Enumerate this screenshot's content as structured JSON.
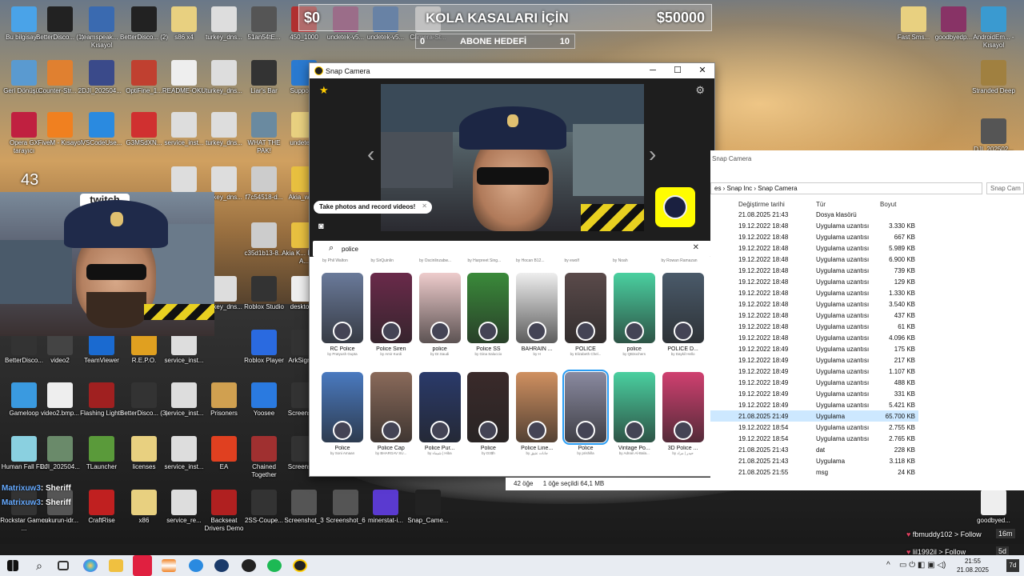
{
  "overlay": {
    "banner_left": "$0",
    "banner_mid": "KOLA KASALARI İÇİN",
    "banner_right": "$50000",
    "abone_left": "0",
    "abone_text": "ABONE HEDEFİ",
    "abone_right": "10",
    "timer": "43"
  },
  "desktop_icons": [
    {
      "label": "Bu bilgisayar",
      "color": "#4aa3e8"
    },
    {
      "label": "BetterDisco... (1)",
      "color": "#222"
    },
    {
      "label": "teamspeak... - Kısayol",
      "color": "#3a6ab0"
    },
    {
      "label": "BetterDisco... (2)",
      "color": "#222"
    },
    {
      "label": "s86 x4",
      "color": "#e8d080"
    },
    {
      "label": "turkey_dns...",
      "color": "#ddd"
    },
    {
      "label": "51an54tE...",
      "color": "#555"
    },
    {
      "label": "450_1000",
      "color": "#b03030"
    },
    {
      "label": "undetek-v5...",
      "color": "#883366"
    },
    {
      "label": "undetek-v5...",
      "color": "#2a5a9a"
    },
    {
      "label": "Camera-St...",
      "color": "#ccc"
    },
    {
      "label": "Fast Sms...",
      "color": "#e8d080"
    },
    {
      "label": "goodbyedp...",
      "color": "#883366"
    },
    {
      "label": "AndroidEm... - Kısayol",
      "color": "#3a9ad0"
    },
    {
      "label": "Geri Dönüşü...",
      "color": "#5a9ad0"
    },
    {
      "label": "Counter-Str... 2",
      "color": "#e08030"
    },
    {
      "label": "DJI_202504...",
      "color": "#3a4a8a"
    },
    {
      "label": "OptiFine_1...",
      "color": "#c04030"
    },
    {
      "label": "README-OKU",
      "color": "#eee"
    },
    {
      "label": "turkey_dns...",
      "color": "#ddd"
    },
    {
      "label": "Liar's Bar",
      "color": "#333"
    },
    {
      "label": "Support...",
      "color": "#2a7ad0"
    },
    {
      "label": "Stranded Deep",
      "color": "#a08040"
    },
    {
      "label": "Opera GX tarayıcı",
      "color": "#c02040"
    },
    {
      "label": "FiveM - Kısayol",
      "color": "#f08020"
    },
    {
      "label": "VSCodeUse...",
      "color": "#2a8ae0"
    },
    {
      "label": "G3MSdXN...",
      "color": "#d03030"
    },
    {
      "label": "service_inst...",
      "color": "#ddd"
    },
    {
      "label": "turkey_dns...",
      "color": "#ddd"
    },
    {
      "label": "WHAT THE PAK!",
      "color": "#6a8aa0"
    },
    {
      "label": "undetek...",
      "color": "#e8d080"
    },
    {
      "label": "DJI_202502...",
      "color": "#555"
    },
    {
      "label": "service_inst...",
      "color": "#ddd"
    },
    {
      "label": "turkey_dns...",
      "color": "#ddd"
    },
    {
      "label": "f7c54518-d...",
      "color": "#ccc"
    },
    {
      "label": "Akia_win...",
      "color": "#e8c040"
    },
    {
      "label": "c35d1b13-8...",
      "color": "#ccc"
    },
    {
      "label": "Akia K... İzleme A...",
      "color": "#e8c040"
    },
    {
      "label": "turkey_dns...",
      "color": "#ddd"
    },
    {
      "label": "Roblox Studio",
      "color": "#333"
    },
    {
      "label": "desktop...",
      "color": "#eee"
    },
    {
      "label": "BetterDisco...",
      "color": "#333"
    },
    {
      "label": "video2",
      "color": "#444"
    },
    {
      "label": "TeamViewer",
      "color": "#1a6ad0"
    },
    {
      "label": "R.E.P.O.",
      "color": "#e0a020"
    },
    {
      "label": "service_inst...",
      "color": "#ddd"
    },
    {
      "label": "Roblox Player",
      "color": "#2a6ae0"
    },
    {
      "label": "ArkSigne...",
      "color": "#333"
    },
    {
      "label": "Gameloop",
      "color": "#3a9ae0"
    },
    {
      "label": "video2.bmp...",
      "color": "#eee"
    },
    {
      "label": "Flashing Lights",
      "color": "#a02020"
    },
    {
      "label": "BetterDisco... (3)",
      "color": "#333"
    },
    {
      "label": "service_inst...",
      "color": "#ddd"
    },
    {
      "label": "Prisoners",
      "color": "#d0a050"
    },
    {
      "label": "Yoosee",
      "color": "#2a7ae0"
    },
    {
      "label": "Screensh...",
      "color": "#333"
    },
    {
      "label": "Human Fall Flat",
      "color": "#8ad0e0"
    },
    {
      "label": "DJI_202504...",
      "color": "#6a8a6a"
    },
    {
      "label": "TLauncher",
      "color": "#5a9a3a"
    },
    {
      "label": "licenses",
      "color": "#e8d080"
    },
    {
      "label": "service_inst...",
      "color": "#ddd"
    },
    {
      "label": "EA",
      "color": "#e04020"
    },
    {
      "label": "Chained Together",
      "color": "#a03030"
    },
    {
      "label": "Screensh...",
      "color": "#333"
    },
    {
      "label": "Rockstar Games ...",
      "color": "#333"
    },
    {
      "label": "cukurun-idr...",
      "color": "#555"
    },
    {
      "label": "CraftRise",
      "color": "#c02020"
    },
    {
      "label": "x86",
      "color": "#e8d080"
    },
    {
      "label": "service_re...",
      "color": "#ddd"
    },
    {
      "label": "Backseat Drivers Demo",
      "color": "#b02020"
    },
    {
      "label": "2SS-Coupe...",
      "color": "#333"
    },
    {
      "label": "Screenshot_3",
      "color": "#555"
    },
    {
      "label": "Screenshot_6",
      "color": "#555"
    },
    {
      "label": "minerstat-i...",
      "color": "#5a3ad0"
    },
    {
      "label": "Snap_Came...",
      "color": "#222"
    },
    {
      "label": "goodbyed...",
      "color": "#eee"
    }
  ],
  "webcam": {
    "twitch_label": "twitch"
  },
  "snap": {
    "window_title": "Snap Camera",
    "min": "─",
    "max": "☐",
    "close": "✕",
    "star": "★",
    "gear": "⚙",
    "prev_arrow": "‹",
    "next_arrow": "›",
    "tooltip": "Take photos and record videos!",
    "tooltip_close": "✕",
    "camera_icon": "◙",
    "search_icon": "⌕",
    "search_value": "police",
    "search_close": "✕",
    "bylines_top": [
      "by Phil Walton",
      "by SirQuinlin",
      "by Oscinlinzabw...",
      "by Harpreet Sing...",
      "by Hocan B12...",
      "by ewolf",
      "by Noah",
      "by Rowan Ramazan"
    ],
    "lenses_row1": [
      {
        "name": "RC Police",
        "by": "by Pratyush Gupta",
        "color": "#6a7a9a"
      },
      {
        "name": "Police Siren",
        "by": "by Amir Kurdi",
        "color": "#6a2a4a"
      },
      {
        "name": "police",
        "by": "by Dr.Saudi",
        "color": "#eecccc"
      },
      {
        "name": "Police SS",
        "by": "by Gina Saluccio",
        "color": "#3a8a3a"
      },
      {
        "name": "BAHRAIN ...",
        "by": "by H",
        "color": "#eee"
      },
      {
        "name": "POLICE",
        "by": "by Elizabeth Chel...",
        "color": "#5a4a4a"
      },
      {
        "name": "police",
        "by": "by QB3ochers",
        "color": "#4ad0a0"
      },
      {
        "name": "POLICE D...",
        "by": "by Daykil Hello",
        "color": "#4a5a6a"
      }
    ],
    "lenses_row2": [
      {
        "name": "Police",
        "by": "by Soni Amaan",
        "color": "#4a7ac0"
      },
      {
        "name": "Police Cap",
        "by": "by BHARGAV SU...",
        "color": "#8a6a5a"
      },
      {
        "name": "Police Pur...",
        "by": "by شيماء | Hiba",
        "color": "#2a3a6a"
      },
      {
        "name": "Police",
        "by": "by D3$h",
        "color": "#3a2a2a"
      },
      {
        "name": "Police Line...",
        "by": "by جانات عتيق",
        "color": "#d09060"
      },
      {
        "name": "Police",
        "by": "by prishilla",
        "color": "#8a8aa0"
      },
      {
        "name": "Vintage Po...",
        "by": "by Adnan Al-Bala...",
        "color": "#4ad0a0"
      },
      {
        "name": "3D Police ...",
        "by": "by حيدر | مراد",
        "color": "#d04070"
      }
    ]
  },
  "explorer": {
    "title": "Snap Camera",
    "breadcrumb": "es  ›  Snap Inc  ›  Snap Camera",
    "search_placeholder": "Snap Cam",
    "headers": {
      "date": "Değiştirme tarihi",
      "type": "Tür",
      "size": "Boyut"
    },
    "rows": [
      {
        "date": "21.08.2025 21:43",
        "type": "Dosya klasörü",
        "size": ""
      },
      {
        "date": "19.12.2022 18:48",
        "type": "Uygulama uzantısı",
        "size": "3.330 KB"
      },
      {
        "date": "19.12.2022 18:48",
        "type": "Uygulama uzantısı",
        "size": "667 KB"
      },
      {
        "date": "19.12.2022 18:48",
        "type": "Uygulama uzantısı",
        "size": "5.989 KB"
      },
      {
        "date": "19.12.2022 18:48",
        "type": "Uygulama uzantısı",
        "size": "6.900 KB"
      },
      {
        "date": "19.12.2022 18:48",
        "type": "Uygulama uzantısı",
        "size": "739 KB"
      },
      {
        "date": "19.12.2022 18:48",
        "type": "Uygulama uzantısı",
        "size": "129 KB"
      },
      {
        "date": "19.12.2022 18:48",
        "type": "Uygulama uzantısı",
        "size": "1.330 KB"
      },
      {
        "date": "19.12.2022 18:48",
        "type": "Uygulama uzantısı",
        "size": "3.540 KB"
      },
      {
        "date": "19.12.2022 18:48",
        "type": "Uygulama uzantısı",
        "size": "437 KB"
      },
      {
        "date": "19.12.2022 18:48",
        "type": "Uygulama uzantısı",
        "size": "61 KB"
      },
      {
        "date": "19.12.2022 18:48",
        "type": "Uygulama uzantısı",
        "size": "4.096 KB"
      },
      {
        "date": "19.12.2022 18:49",
        "type": "Uygulama uzantısı",
        "size": "175 KB"
      },
      {
        "date": "19.12.2022 18:49",
        "type": "Uygulama uzantısı",
        "size": "217 KB"
      },
      {
        "date": "19.12.2022 18:49",
        "type": "Uygulama uzantısı",
        "size": "1.107 KB"
      },
      {
        "date": "19.12.2022 18:49",
        "type": "Uygulama uzantısı",
        "size": "488 KB"
      },
      {
        "date": "19.12.2022 18:49",
        "type": "Uygulama uzantısı",
        "size": "331 KB"
      },
      {
        "date": "19.12.2022 18:49",
        "type": "Uygulama uzantısı",
        "size": "5.421 KB"
      },
      {
        "date": "21.08.2025 21:49",
        "type": "Uygulama",
        "size": "65.700 KB"
      },
      {
        "date": "19.12.2022 18:54",
        "type": "Uygulama uzantısı",
        "size": "2.755 KB"
      },
      {
        "date": "19.12.2022 18:54",
        "type": "Uygulama uzantısı",
        "size": "2.765 KB"
      },
      {
        "date": "21.08.2025 21:43",
        "type": "dat",
        "size": "228 KB"
      },
      {
        "date": "21.08.2025 21:43",
        "type": "Uygulama",
        "size": "3.118 KB"
      },
      {
        "date": "21.08.2025 21:55",
        "type": "msg",
        "size": "24 KB"
      }
    ],
    "status_count": "42 öğe",
    "status_selected": "1 öğe seçildi  64,1 MB"
  },
  "chat": [
    {
      "user": "Matrixuw3",
      "msg": ": Sheriff"
    },
    {
      "user": "Matrixuw3",
      "msg": ": Sheriff"
    }
  ],
  "follows": [
    {
      "text": "fbmuddy102 > Follow",
      "time": "16m"
    },
    {
      "text": "lil1992il > Follow",
      "time": "5d"
    }
  ],
  "taskbar": {
    "clock_time": "21:55",
    "clock_date": "21.08.2025",
    "tray_up": "^",
    "notif": "7d"
  }
}
